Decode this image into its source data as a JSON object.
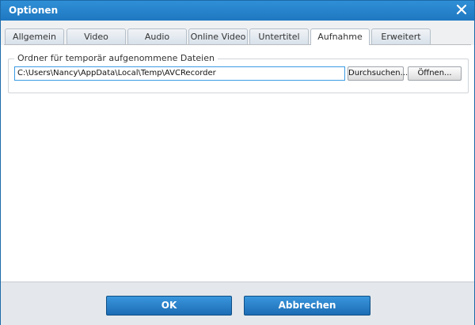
{
  "window": {
    "title": "Optionen"
  },
  "tabs": [
    {
      "label": "Allgemein"
    },
    {
      "label": "Video"
    },
    {
      "label": "Audio"
    },
    {
      "label": "Online Video"
    },
    {
      "label": "Untertitel"
    },
    {
      "label": "Aufnahme",
      "active": true
    },
    {
      "label": "Erweitert"
    }
  ],
  "recording": {
    "group_label": "Ordner für temporär aufgenommene Dateien",
    "folder_path": "C:\\Users\\Nancy\\AppData\\Local\\Temp\\AVCRecorder",
    "browse_label": "Durchsuchen...",
    "open_label": "Öffnen..."
  },
  "footer": {
    "ok_label": "OK",
    "cancel_label": "Abbrechen"
  },
  "colors": {
    "titlebar": "#1f78c1",
    "accent_button": "#1c6cb4",
    "input_border": "#3b9be3"
  },
  "icons": {
    "close": "close-icon"
  }
}
